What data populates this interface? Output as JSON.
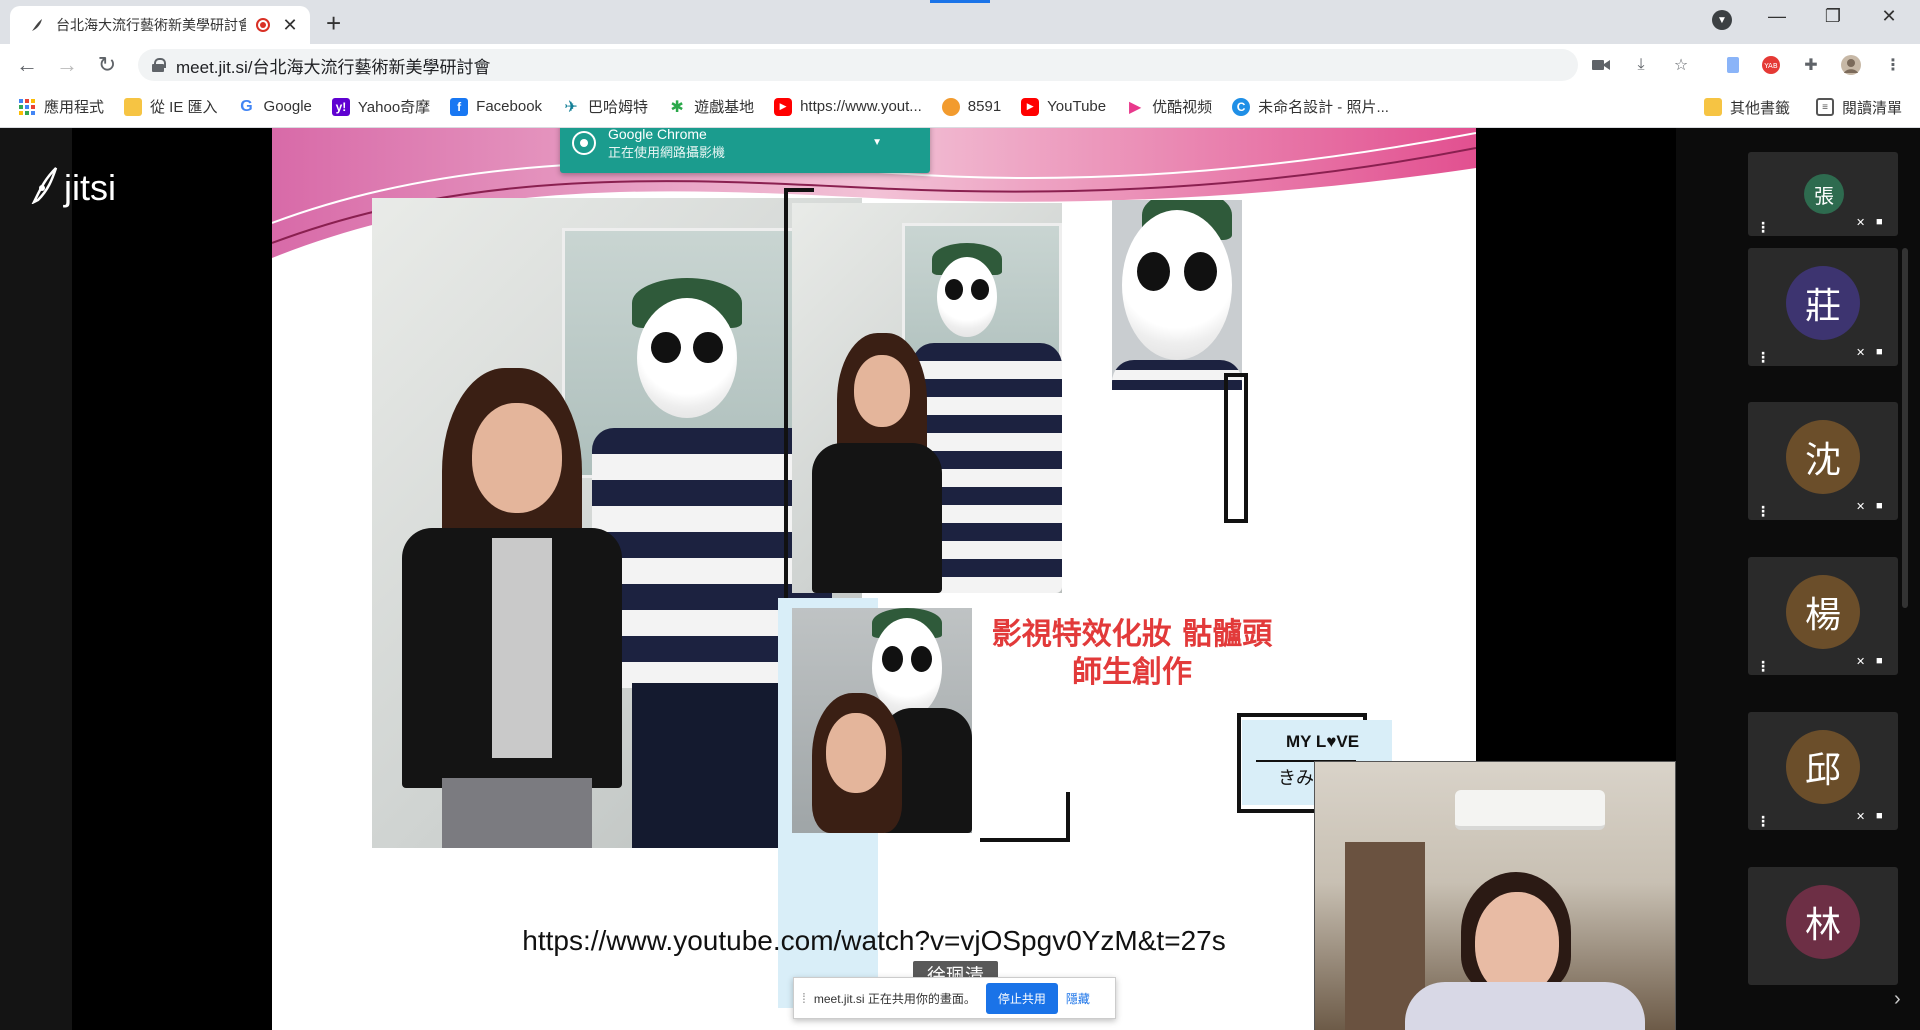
{
  "browser": {
    "tab_title": "台北海大流行藝術新美學研討會",
    "new_tab": "+",
    "close": "✕",
    "url": "meet.jit.si/台北海大流行藝術新美學研討會",
    "window": {
      "minimize": "—",
      "restore": "❐",
      "close": "✕"
    }
  },
  "bookmarks": [
    {
      "label": "應用程式",
      "icon": "apps-icon",
      "color": "#4285f4"
    },
    {
      "label": "從 IE 匯入",
      "icon": "folder-icon",
      "color": "#f6c443"
    },
    {
      "label": "Google",
      "icon": "google-icon",
      "color": "#4285f4"
    },
    {
      "label": "Yahoo奇摩",
      "icon": "yahoo-icon",
      "color": "#5f01d1"
    },
    {
      "label": "Facebook",
      "icon": "facebook-icon",
      "color": "#1877f2"
    },
    {
      "label": "巴哈姆特",
      "icon": "bahamut-icon",
      "color": "#117e96"
    },
    {
      "label": "遊戲基地",
      "icon": "gamebase-icon",
      "color": "#2ba84a"
    },
    {
      "label": "https://www.yout...",
      "icon": "youtube-icon",
      "color": "#ff0000"
    },
    {
      "label": "8591",
      "icon": "8591-icon",
      "color": "#f29b2e"
    },
    {
      "label": "YouTube",
      "icon": "youtube-icon",
      "color": "#ff0000"
    },
    {
      "label": "优酷视频",
      "icon": "youku-icon",
      "color": "#e8398c"
    },
    {
      "label": "未命名設計 - 照片...",
      "icon": "canva-icon",
      "color": "#1f8fe6"
    }
  ],
  "bookmarks_right": [
    {
      "label": "其他書籤",
      "icon": "folder-icon"
    },
    {
      "label": "閱讀清單",
      "icon": "reading-list-icon"
    }
  ],
  "jitsi": {
    "logo": "jitsi"
  },
  "notification": {
    "app": "Google Chrome",
    "message": "正在使用網路攝影機"
  },
  "slide": {
    "caption_line1": "影視特效化妝 骷髗頭",
    "caption_line2": "師生創作",
    "mylove_title": "MY L♥VE",
    "mylove_sub": "きみにと",
    "url": "https://www.youtube.com/watch?v=vjOSpgv0YzM&t=27s"
  },
  "speaker": {
    "name": "徐珮清"
  },
  "share_bar": {
    "message": "meet.jit.si 正在共用你的畫面。",
    "stop_label": "停止共用",
    "hide_label": "隱藏"
  },
  "participants": [
    {
      "initial": "張",
      "color": "#2e6b4f"
    },
    {
      "initial": "莊",
      "color": "#3d3470"
    },
    {
      "initial": "沈",
      "color": "#6b4e2a"
    },
    {
      "initial": "楊",
      "color": "#6b4e2a"
    },
    {
      "initial": "邱",
      "color": "#6b4e2a"
    },
    {
      "initial": "林",
      "color": "#6d2f45"
    }
  ],
  "colors": {
    "accent": "#1a73e8",
    "notification": "#1b9c8e",
    "caption": "#e23a3a"
  }
}
